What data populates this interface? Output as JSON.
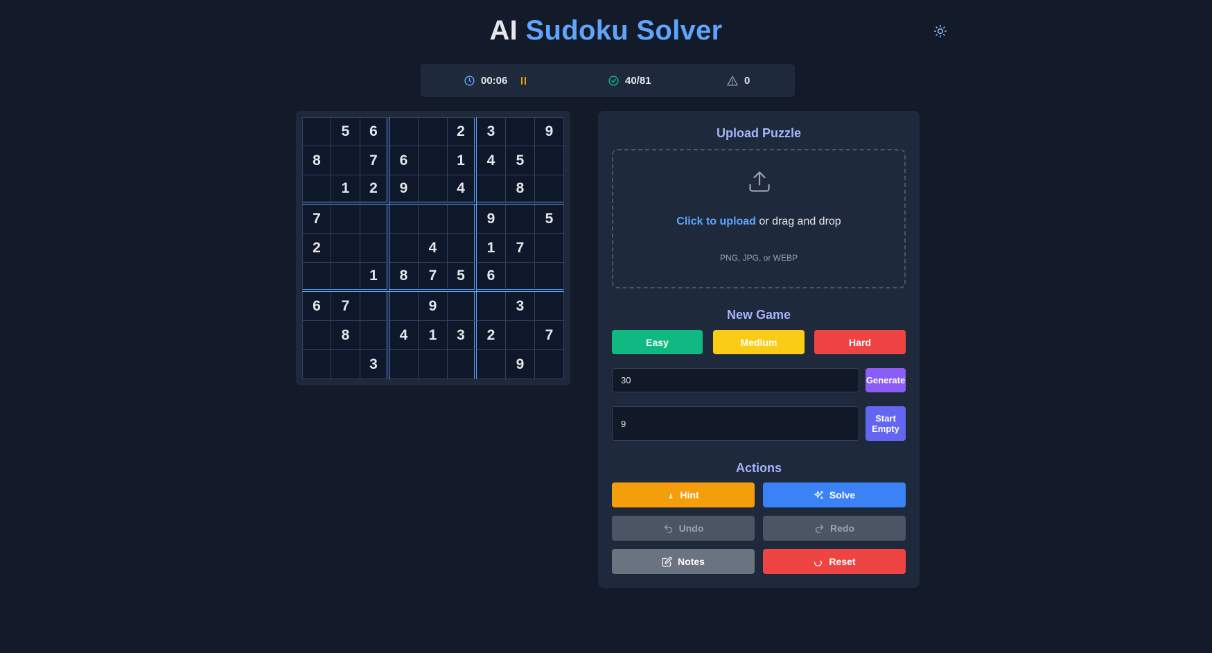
{
  "header": {
    "title_prefix": "AI",
    "title_main": "Sudoku Solver"
  },
  "stats": {
    "timer": "00:06",
    "filled": "40/81",
    "errors": "0"
  },
  "board": [
    [
      "",
      "5",
      "6",
      "",
      "",
      "2",
      "3",
      "",
      "9"
    ],
    [
      "8",
      "",
      "7",
      "6",
      "",
      "1",
      "4",
      "5",
      ""
    ],
    [
      "",
      "1",
      "2",
      "9",
      "",
      "4",
      "",
      "8",
      ""
    ],
    [
      "7",
      "",
      "",
      "",
      "",
      "",
      "9",
      "",
      "5"
    ],
    [
      "2",
      "",
      "",
      "",
      "4",
      "",
      "1",
      "7",
      ""
    ],
    [
      "",
      "",
      "1",
      "8",
      "7",
      "5",
      "6",
      "",
      ""
    ],
    [
      "6",
      "7",
      "",
      "",
      "9",
      "",
      "",
      "3",
      ""
    ],
    [
      "",
      "8",
      "",
      "4",
      "1",
      "3",
      "2",
      "",
      "7"
    ],
    [
      "",
      "",
      "3",
      "",
      "",
      "",
      "",
      "9",
      ""
    ]
  ],
  "upload": {
    "title": "Upload Puzzle",
    "link_text": "Click to upload",
    "rest_text": " or drag and drop",
    "formats": "PNG, JPG, or WEBP"
  },
  "new_game": {
    "title": "New Game",
    "easy": "Easy",
    "medium": "Medium",
    "hard": "Hard",
    "clues_value": "30",
    "generate": "Generate",
    "size_value": "9",
    "start_line1": "Start",
    "start_line2": "Empty"
  },
  "actions": {
    "title": "Actions",
    "hint": "Hint",
    "solve": "Solve",
    "undo": "Undo",
    "redo": "Redo",
    "notes": "Notes",
    "reset": "Reset"
  },
  "colors": {
    "background": "#131a2a",
    "panel": "#1e293b",
    "accent": "#60a5fa",
    "easy": "#10b981",
    "medium": "#facc15",
    "hard": "#ef4444",
    "generate": "#8b5cf6",
    "start_empty": "#6366f1",
    "hint": "#f59e0b",
    "solve": "#3b82f6"
  },
  "icons": {
    "theme": "sun-icon",
    "timer": "clock-icon",
    "pause": "pause-icon",
    "filled": "check-circle-icon",
    "errors": "warning-triangle-icon",
    "upload": "upload-icon",
    "hint": "lightbulb-icon",
    "solve": "sparkles-icon",
    "undo": "undo-icon",
    "redo": "redo-icon",
    "notes": "pencil-icon",
    "reset": "reset-icon"
  }
}
